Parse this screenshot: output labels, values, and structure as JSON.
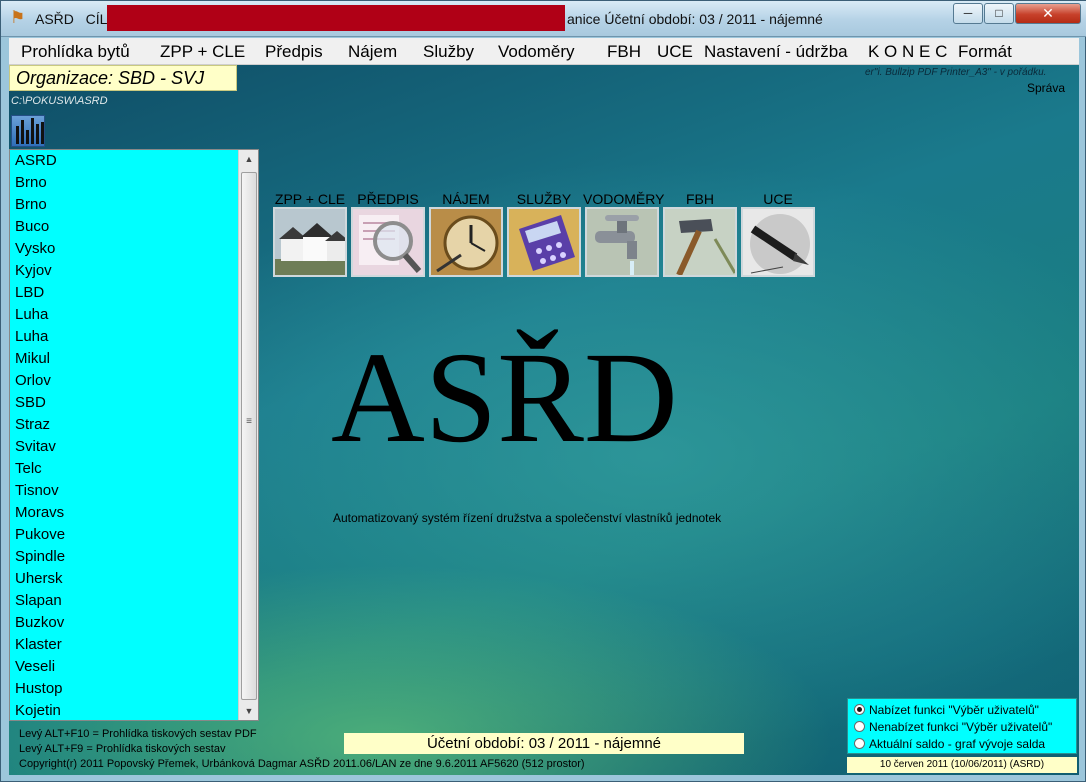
{
  "titlebar": {
    "app_name": "ASŘD",
    "target_label": "CÍL,",
    "right_text": "anice  Účetní období:  03 / 2011 - nájemné"
  },
  "menu": [
    {
      "label": "Prohlídka bytů"
    },
    {
      "label": "ZPP + CLE"
    },
    {
      "label": "Předpis"
    },
    {
      "label": "Nájem"
    },
    {
      "label": "Služby"
    },
    {
      "label": "Vodoměry"
    },
    {
      "label": "FBH"
    },
    {
      "label": "UCE"
    },
    {
      "label": "Nastavení - údržba"
    },
    {
      "label": "K O N E C"
    },
    {
      "label": "Formát"
    }
  ],
  "organization": "Organizace:  SBD - SVJ",
  "path": "C:\\POKUSW\\ASRD",
  "printer_note": "er\"i. Bullzip PDF Printer_A3\" - v pořádku.",
  "sprava": "Správa",
  "list_items": [
    "ASRD",
    "Brno",
    "Brno",
    "Buco",
    "Vysko",
    "Kyjov",
    "LBD",
    "Luha",
    "Luha",
    "Mikul",
    "Orlov",
    "SBD",
    "Straz",
    "Svitav",
    "Telc",
    "Tisnov",
    "Moravs",
    "Pukove",
    "Spindle",
    "Uhersk",
    "Slapan",
    "Buzkov",
    "Klaster",
    "Veseli",
    "Hustop",
    "Kojetin"
  ],
  "modules": [
    {
      "label": "ZPP + CLE"
    },
    {
      "label": "PŘEDPIS"
    },
    {
      "label": "NÁJEM"
    },
    {
      "label": "SLUŽBY"
    },
    {
      "label": "VODOMĚRY"
    },
    {
      "label": "FBH"
    },
    {
      "label": "UCE"
    }
  ],
  "brand": {
    "title": "ASŘD",
    "subtitle": "Automatizovaný systém řízení družstva a společenství vlastníků jednotek"
  },
  "footer": {
    "shortcut_pdf": "Levý ALT+F10 = Prohlídka tiskových sestav PDF",
    "shortcut_view": "Levý ALT+F9 = Prohlídka tiskových sestav",
    "copyright": "Copyright(r) 2011 Popovský Přemek, Urbánková Dagmar ASŘD 2011.06/LAN ze dne 9.6.2011 AF5620 (512 prostor)",
    "period": "Účetní období:  03 / 2011 - nájemné",
    "date": "10 červen 2011 (10/06/2011) (ASRD)"
  },
  "options": [
    {
      "label": "Nabízet funkci \"Výběr uživatelů\"",
      "selected": true
    },
    {
      "label": "Nenabízet funkci \"Výběr uživatelů\"",
      "selected": false
    },
    {
      "label": "Aktuální saldo - graf vývoje salda",
      "selected": false
    }
  ],
  "colors": {
    "list_background": "#00ffff",
    "info_background": "#ffffc8",
    "title_redaction": "#b00016"
  }
}
